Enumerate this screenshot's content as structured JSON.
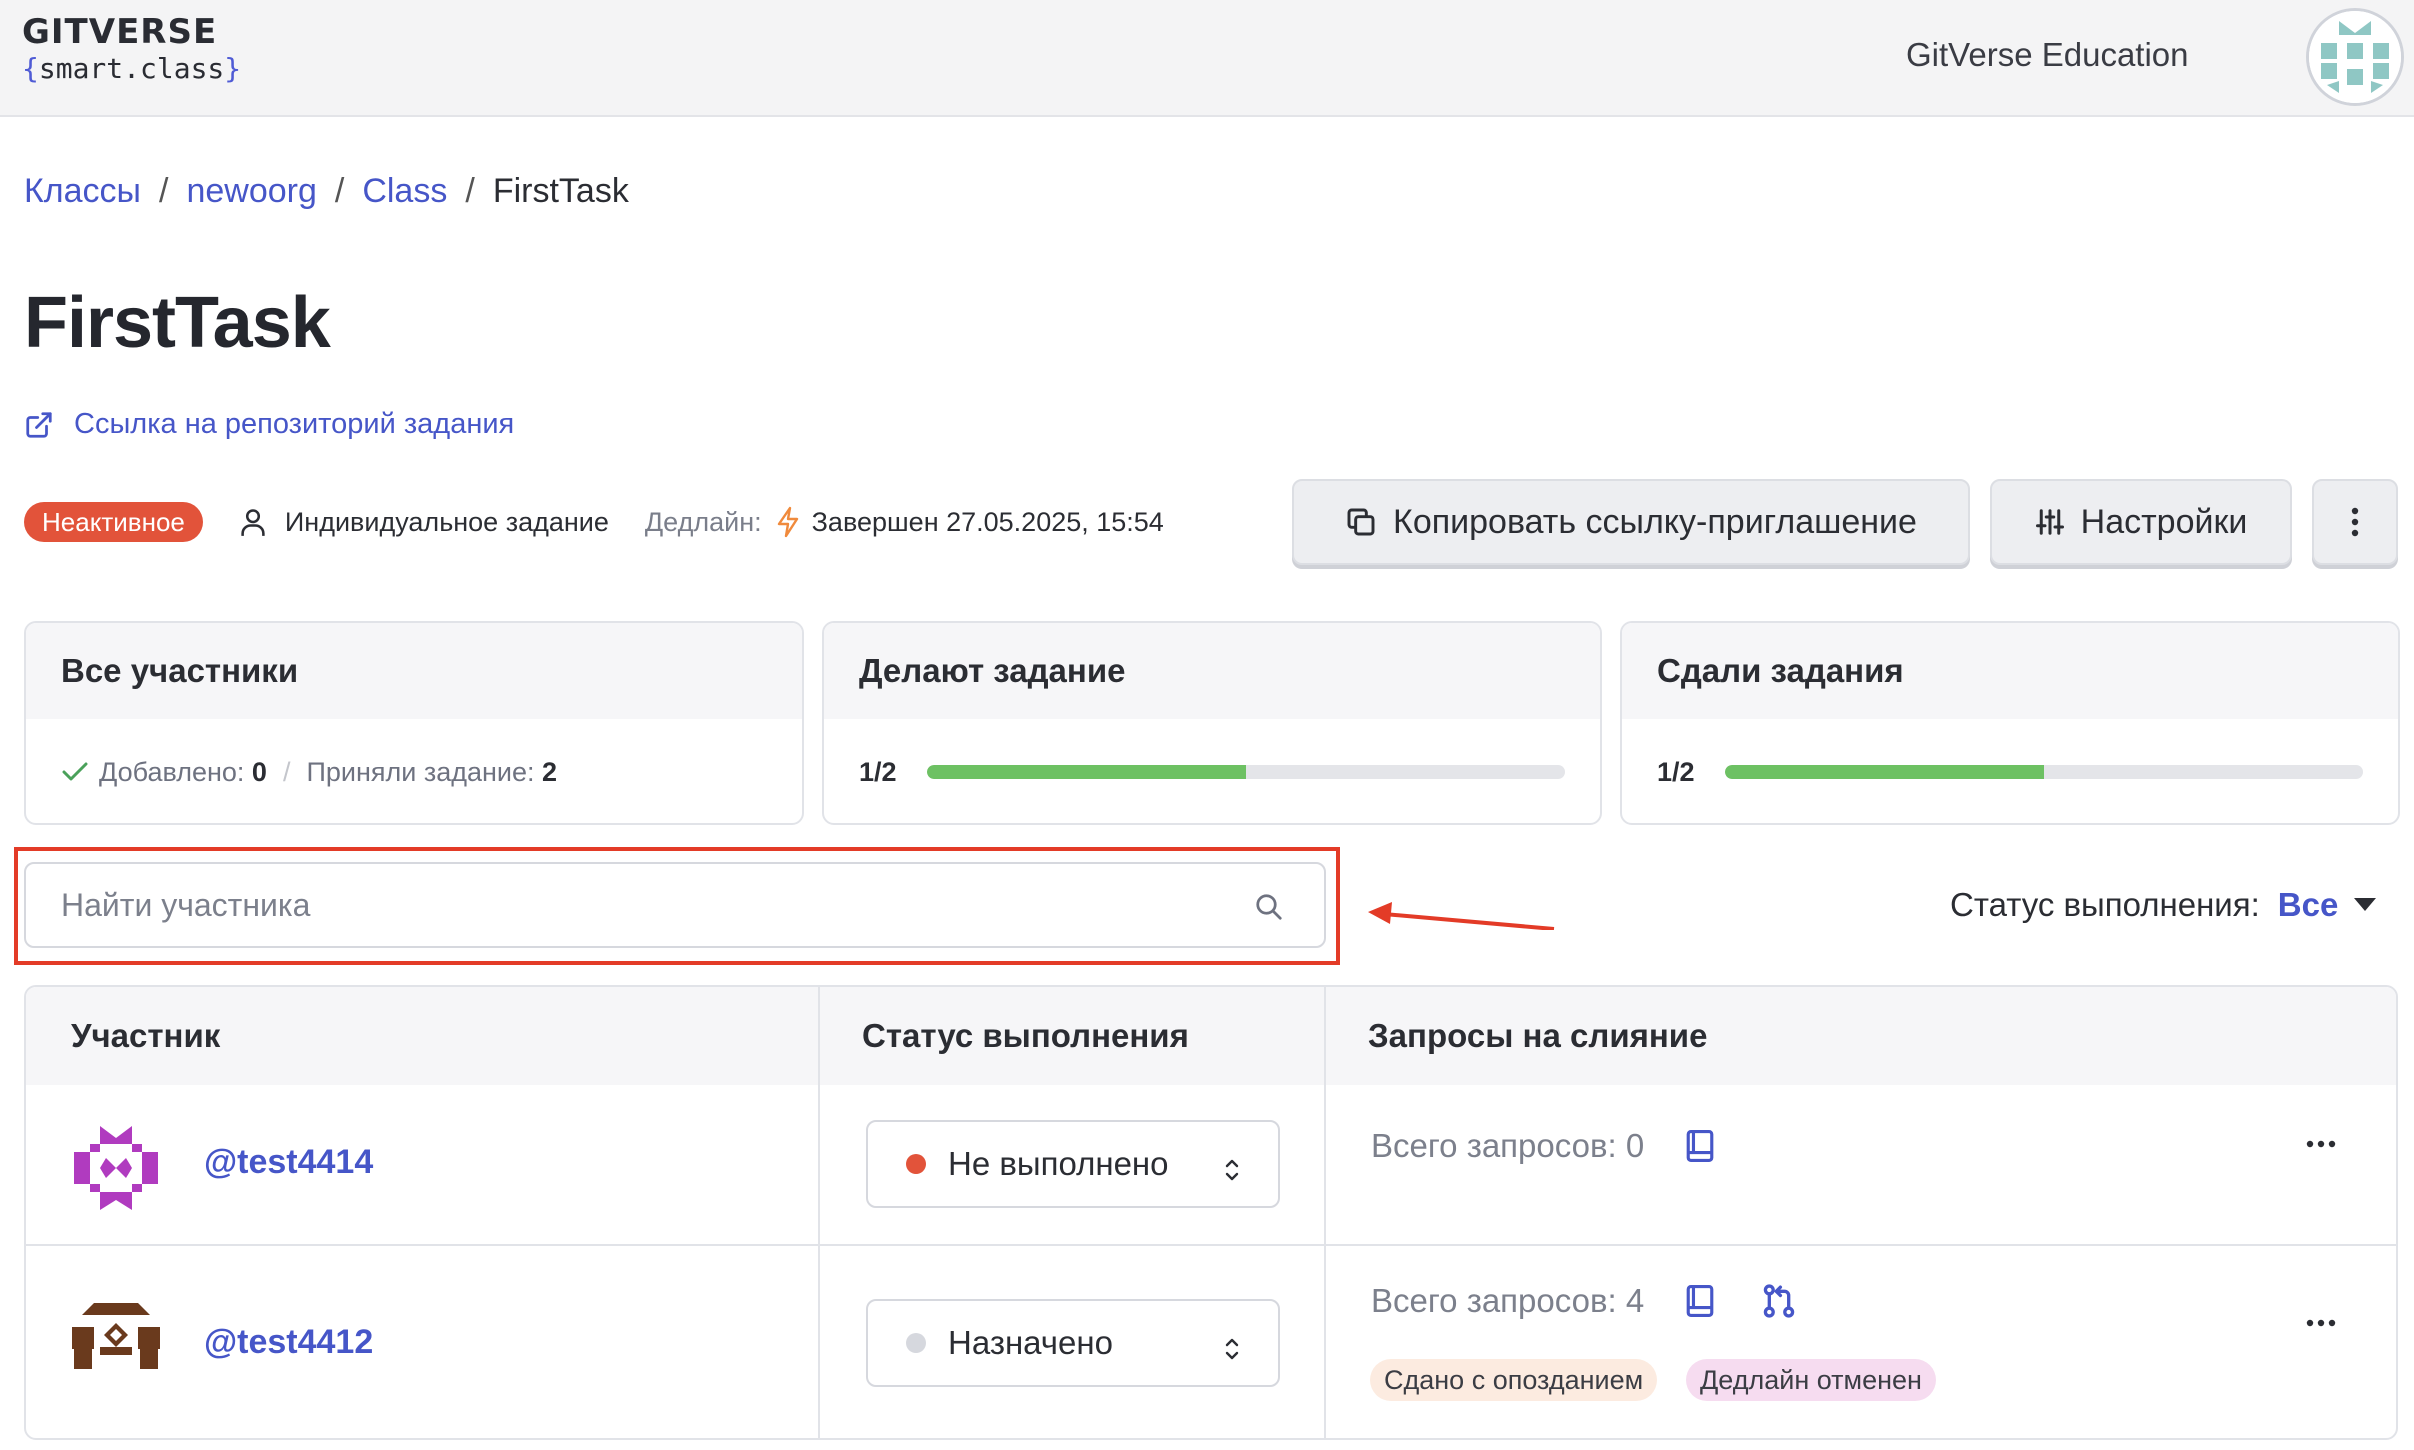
{
  "header": {
    "logo_title": "GITVERSE",
    "logo_sub_open": "{",
    "logo_sub_text": "smart.class",
    "logo_sub_close": "}",
    "org_name": "GitVerse Education"
  },
  "breadcrumbs": {
    "items": [
      "Классы",
      "newoorg",
      "Class"
    ],
    "current": "FirstTask",
    "separator": "/"
  },
  "task": {
    "title": "FirstTask",
    "repo_link": "Ссылка на репозиторий задания",
    "status_badge": "Неактивное",
    "type": "Индивидуальное задание",
    "deadline_label": "Дедлайн:",
    "deadline_value": "Завершен 27.05.2025, 15:54"
  },
  "actions": {
    "copy_invite": "Копировать ссылку-приглашение",
    "settings": "Настройки"
  },
  "stats": {
    "all": {
      "title": "Все участники",
      "added_label": "Добавлено:",
      "added_value": "0",
      "accepted_label": "Приняли задание:",
      "accepted_value": "2"
    },
    "doing": {
      "title": "Делают задание",
      "fraction": "1/2",
      "progress": 0.5
    },
    "submitted": {
      "title": "Сдали задания",
      "fraction": "1/2",
      "progress": 0.5
    }
  },
  "search": {
    "placeholder": "Найти участника"
  },
  "filter": {
    "label": "Статус выполнения:",
    "value": "Все"
  },
  "table": {
    "headers": [
      "Участник",
      "Статус выполнения",
      "Запросы на слияние"
    ],
    "rows": [
      {
        "username": "@test4414",
        "status": "Не выполнено",
        "status_color": "#e2533a",
        "mr_total": "Всего запросов: 0",
        "tags": []
      },
      {
        "username": "@test4412",
        "status": "Назначено",
        "status_color": "#d6d8de",
        "mr_total": "Всего запросов: 4",
        "tags": [
          "Сдано с опозданием",
          "Дедлайн отменен"
        ]
      }
    ]
  },
  "colors": {
    "accent": "#4656c8",
    "badge_inactive": "#e2533a",
    "progress": "#6dc163",
    "highlight": "#e33b27"
  }
}
